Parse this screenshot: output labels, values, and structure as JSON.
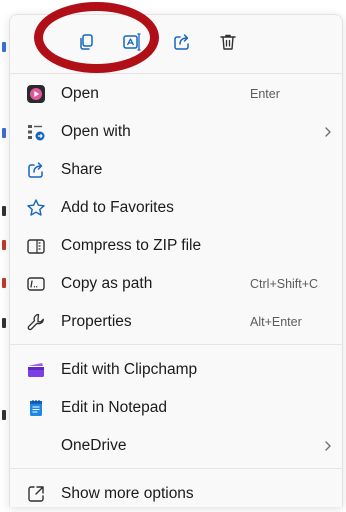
{
  "toolbar": {
    "buttons": [
      {
        "name": "copy",
        "icon": "copy-icon"
      },
      {
        "name": "rename",
        "icon": "rename-icon"
      },
      {
        "name": "share",
        "icon": "share-icon"
      },
      {
        "name": "delete",
        "icon": "trash-icon"
      }
    ]
  },
  "items": {
    "open": {
      "label": "Open",
      "shortcut": "Enter",
      "icon": "media-player-icon"
    },
    "open_with": {
      "label": "Open with",
      "icon": "open-with-icon"
    },
    "share": {
      "label": "Share",
      "icon": "share-icon"
    },
    "favorites": {
      "label": "Add to Favorites",
      "icon": "star-icon"
    },
    "compress": {
      "label": "Compress to ZIP file",
      "icon": "zip-folder-icon"
    },
    "copy_path": {
      "label": "Copy as path",
      "shortcut": "Ctrl+Shift+C",
      "icon": "copy-path-icon"
    },
    "properties": {
      "label": "Properties",
      "shortcut": "Alt+Enter",
      "icon": "wrench-icon"
    },
    "clipchamp": {
      "label": "Edit with Clipchamp",
      "icon": "clipchamp-icon"
    },
    "notepad": {
      "label": "Edit in Notepad",
      "icon": "notepad-icon"
    },
    "onedrive": {
      "label": "OneDrive"
    },
    "more": {
      "label": "Show more options",
      "icon": "expand-icon"
    }
  },
  "colors": {
    "menu_bg": "#f9f9f9",
    "accent_blue": "#1565c0",
    "annotation_red": "#b10f17",
    "clipchamp_purple": "#7b3fe4",
    "notepad_blue": "#1e88e5"
  }
}
